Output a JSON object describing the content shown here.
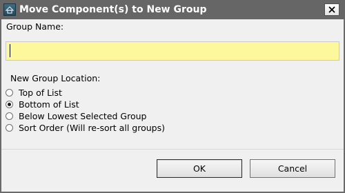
{
  "window": {
    "title": "Move Component(s) to New Group",
    "app_icon": "home-designer-icon",
    "close_icon": "close-icon"
  },
  "form": {
    "group_name_label": "Group Name:",
    "group_name_value": "",
    "location_label": "New Group Location:",
    "options": [
      {
        "label": "Top of List",
        "checked": false
      },
      {
        "label": "Bottom of List",
        "checked": true
      },
      {
        "label": "Below Lowest Selected Group",
        "checked": false
      },
      {
        "label": "Sort Order (Will re-sort all groups)",
        "checked": false
      }
    ]
  },
  "buttons": {
    "ok_label": "OK",
    "cancel_label": "Cancel"
  },
  "colors": {
    "titlebar": "#666666",
    "input_background": "#fdf89c",
    "dialog_background": "#f0f0f0"
  }
}
